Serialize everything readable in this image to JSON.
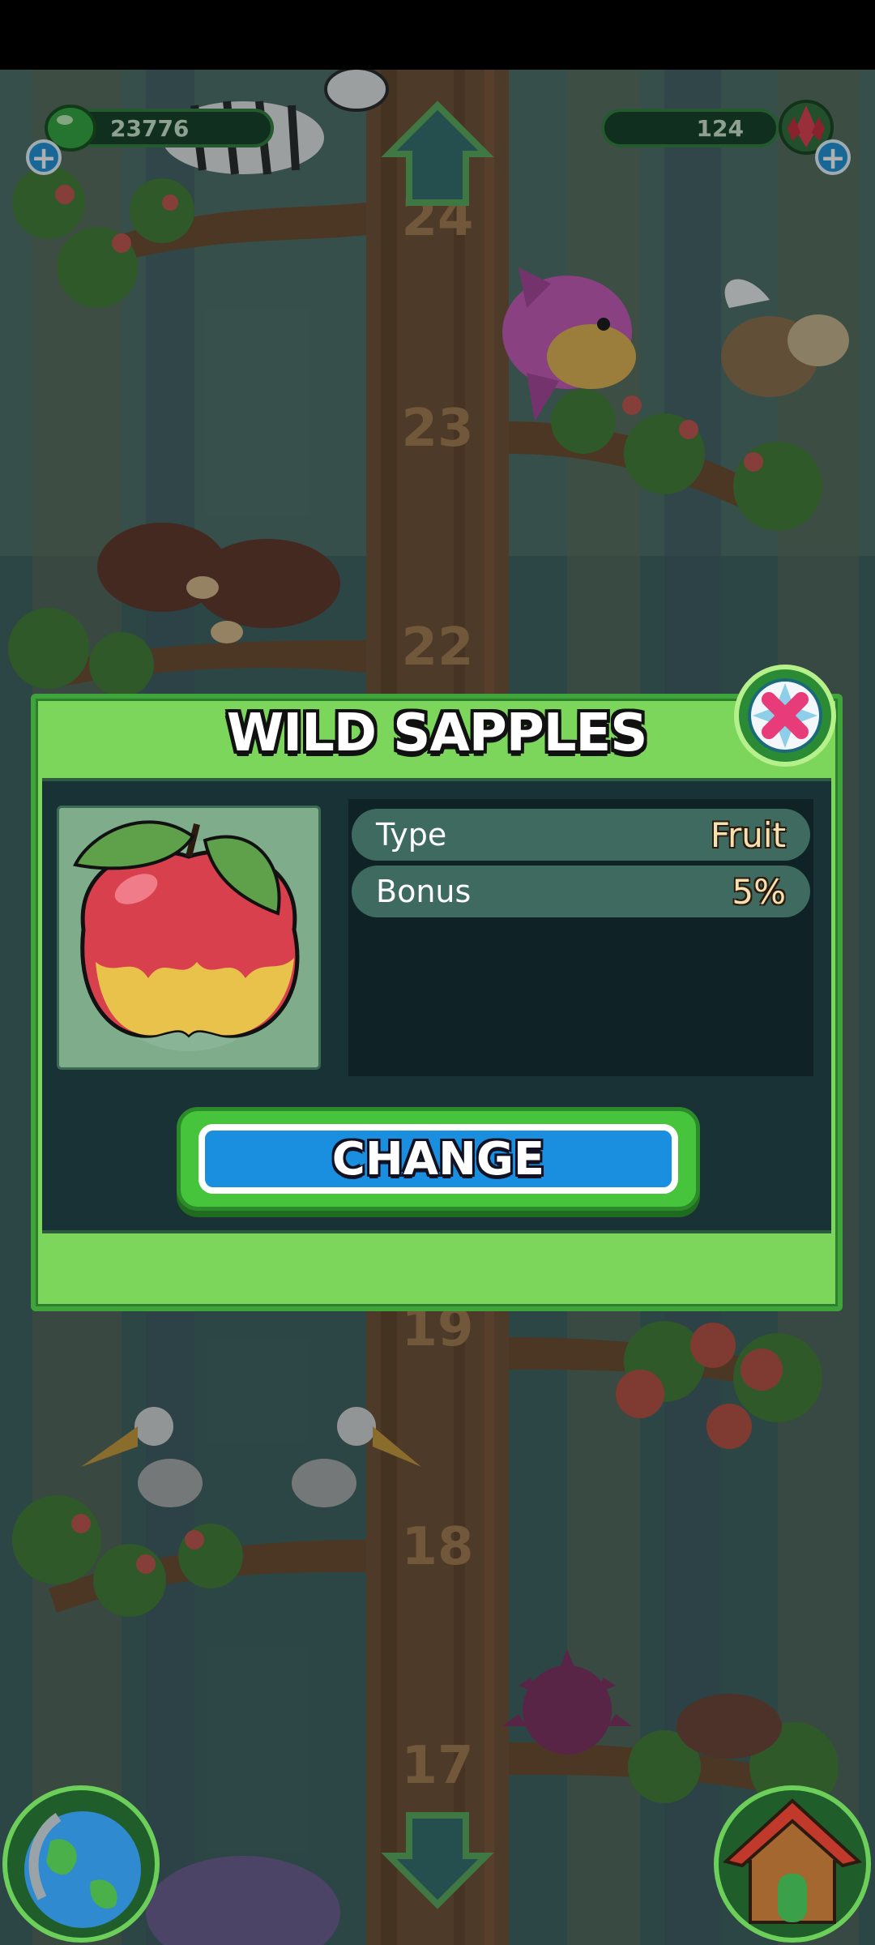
{
  "hud": {
    "currency_left": "23776",
    "currency_right": "124"
  },
  "tree_level_markers": [
    "24",
    "23",
    "22",
    "19",
    "18",
    "17"
  ],
  "dialog": {
    "title": "WILD SAPPLES",
    "item_image": "apple-icon",
    "stats": [
      {
        "label": "Type",
        "value": "Fruit"
      },
      {
        "label": "Bonus",
        "value": "5%"
      }
    ],
    "change_label": "CHANGE",
    "close_icon": "close-icon"
  },
  "corner_buttons": {
    "left_icon": "globe-icon",
    "right_icon": "house-icon"
  },
  "colors": {
    "dialog_green": "#7dd65c",
    "dialog_dark": "#193235",
    "button_blue": "#1a8fe0",
    "close_pink": "#e83b7a"
  }
}
